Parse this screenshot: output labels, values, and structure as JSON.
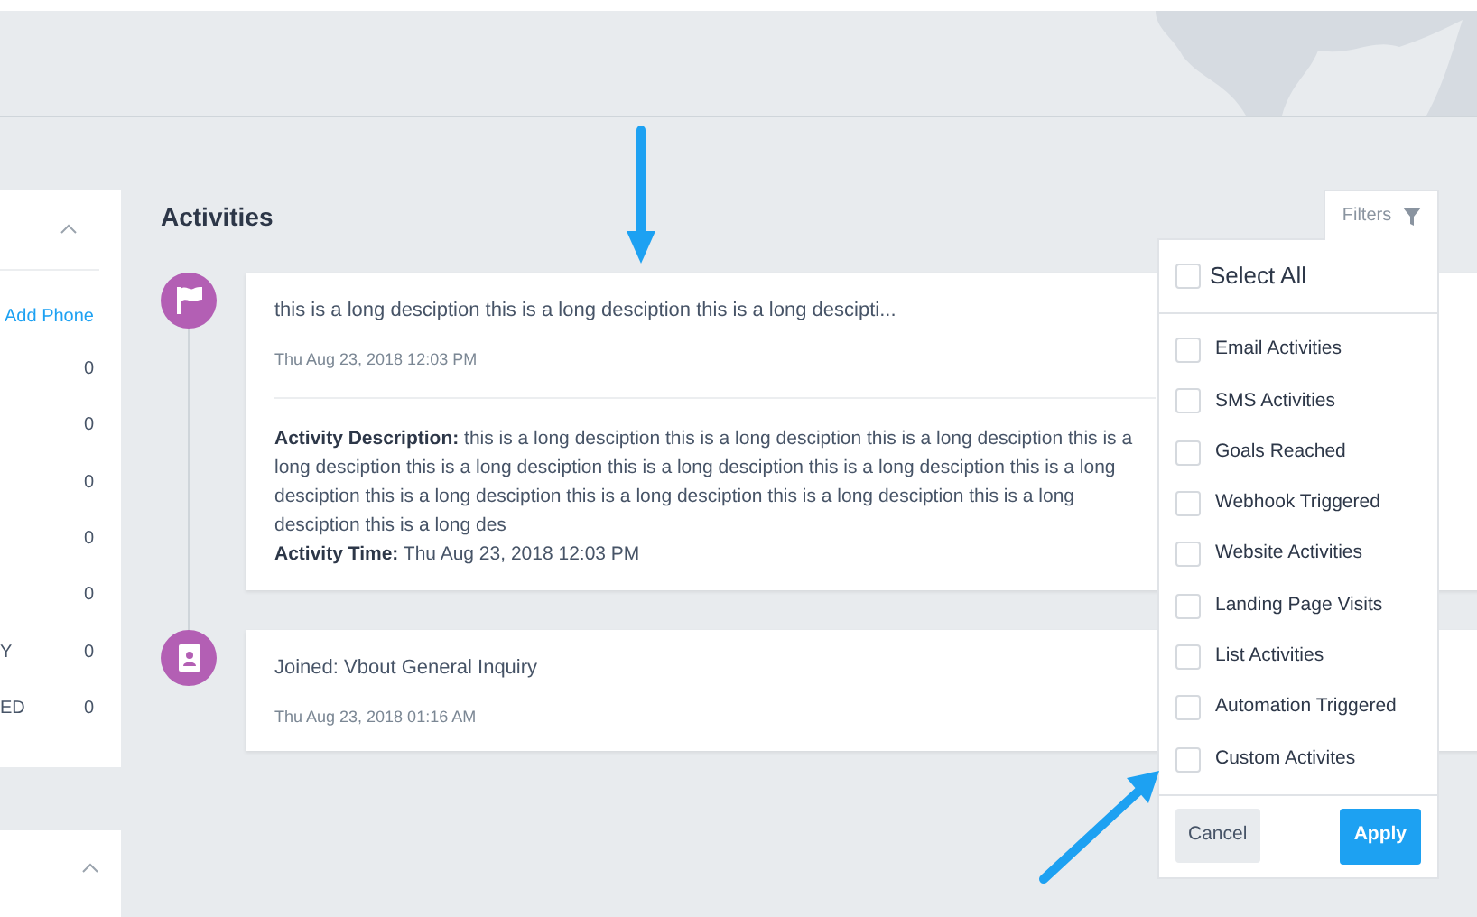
{
  "side_panel": {
    "link": "Add Phone",
    "rows": [
      {
        "value": "0"
      },
      {
        "value": "0"
      },
      {
        "value": "0"
      },
      {
        "value": "0"
      },
      {
        "value": "0"
      },
      {
        "label": "Y",
        "value": "0"
      },
      {
        "label": "ED",
        "value": "0"
      }
    ]
  },
  "activities": {
    "title": "Activities",
    "items": [
      {
        "kind": "flag",
        "summary": "this is a long desciption this is a long desciption this is a long descipti...",
        "time": "Thu Aug 23, 2018 12:03 PM",
        "details": [
          {
            "label": "Activity Description:",
            "value": "this is a long desciption this is a long desciption this is a long desciption this is a long desciption this is a long desciption this is a long desciption this is a long desciption this is a long desciption this is a long desciption this is a long desciption this is a long desciption this is a long desciption this is a long des"
          },
          {
            "label": "Activity Time:",
            "value": "Thu Aug 23, 2018 12:03 PM"
          }
        ]
      },
      {
        "kind": "contact",
        "summary": "Joined: Vbout General Inquiry",
        "time": "Thu Aug 23, 2018 01:16 AM"
      }
    ]
  },
  "filters": {
    "label": "Filters",
    "select_all": {
      "label": "Select All",
      "checked": false
    },
    "options": [
      {
        "label": "Email Activities",
        "checked": false
      },
      {
        "label": "SMS Activities",
        "checked": false
      },
      {
        "label": "Goals Reached",
        "checked": false
      },
      {
        "label": "Webhook Triggered",
        "checked": false
      },
      {
        "label": "Website Activities",
        "checked": false
      },
      {
        "label": "Landing Page Visits",
        "checked": false
      },
      {
        "label": "List Activities",
        "checked": false
      },
      {
        "label": "Automation Triggered",
        "checked": false
      },
      {
        "label": "Custom Activites",
        "checked": false
      }
    ],
    "cancel": "Cancel",
    "apply": "Apply"
  }
}
